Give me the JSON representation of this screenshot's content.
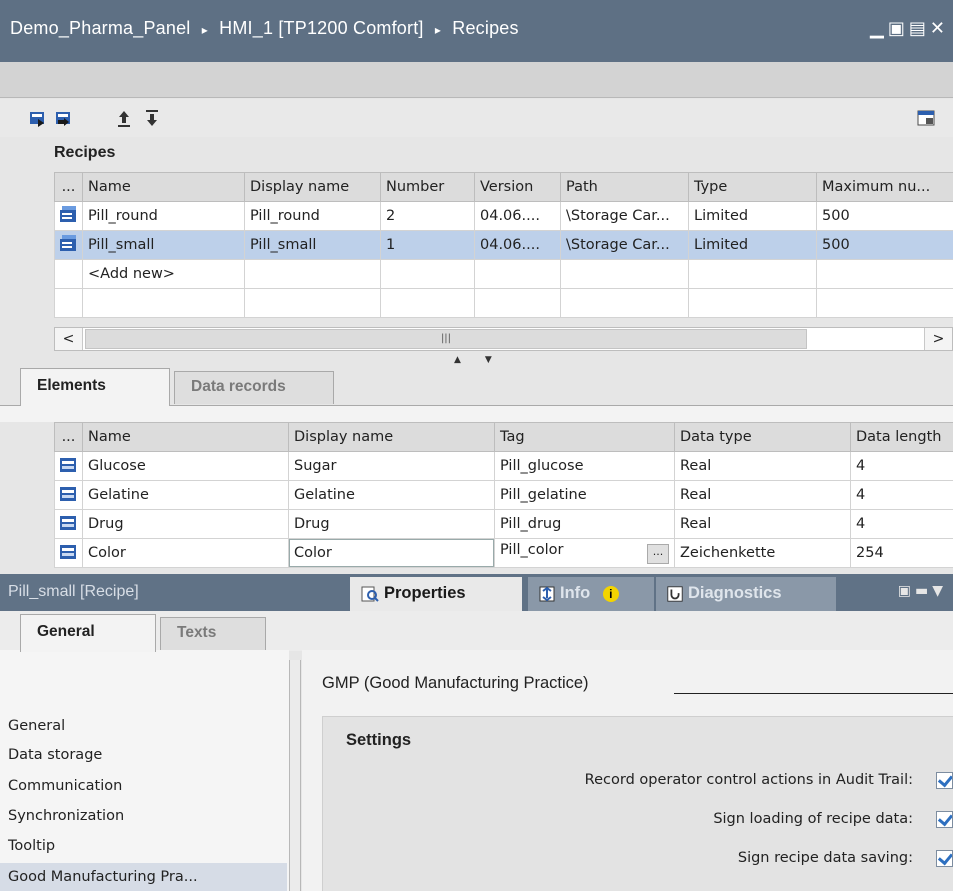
{
  "window": {
    "breadcrumb": [
      "Demo_Pharma_Panel",
      "HMI_1 [TP1200 Comfort]",
      "Recipes"
    ],
    "separator": "▸",
    "controls": "▁ ▣ ▤ ✕"
  },
  "recipes": {
    "title": "Recipes",
    "columns": [
      "...",
      "Name",
      "Display name",
      "Number",
      "Version",
      "Path",
      "Type",
      "Maximum nu..."
    ],
    "rows": [
      {
        "name": "Pill_round",
        "display_name": "Pill_round",
        "number": "2",
        "version": "04.06....",
        "path": "\\Storage Car...",
        "type": "Limited",
        "max": "500",
        "selected": false
      },
      {
        "name": "Pill_small",
        "display_name": "Pill_small",
        "number": "1",
        "version": "04.06....",
        "path": "\\Storage Car...",
        "type": "Limited",
        "max": "500",
        "selected": true
      }
    ],
    "add_new": "<Add new>",
    "scroll_grip": "|||"
  },
  "detail_tabs": [
    "Elements",
    "Data records"
  ],
  "elements": {
    "columns": [
      "...",
      "Name",
      "Display name",
      "Tag",
      "Data type",
      "Data length"
    ],
    "rows": [
      {
        "name": "Glucose",
        "display_name": "Sugar",
        "tag": "Pill_glucose",
        "data_type": "Real",
        "data_length": "4"
      },
      {
        "name": "Gelatine",
        "display_name": "Gelatine",
        "tag": "Pill_gelatine",
        "data_type": "Real",
        "data_length": "4"
      },
      {
        "name": "Drug",
        "display_name": "Drug",
        "tag": "Pill_drug",
        "data_type": "Real",
        "data_length": "4"
      },
      {
        "name": "Color",
        "display_name": "Color",
        "tag": "Pill_color",
        "data_type": "Zeichenkette",
        "data_length": "254"
      }
    ],
    "ellipsis": "..."
  },
  "inspector": {
    "object": "Pill_small [Recipe]",
    "tabs": {
      "properties": "Properties",
      "info": "Info",
      "diagnostics": "Diagnostics"
    },
    "info_badge": "i",
    "sub_tabs": [
      "General",
      "Texts"
    ],
    "nav": [
      "General",
      "Data storage",
      "Communication",
      "Synchronization",
      "Tooltip",
      "Good Manufacturing Pra..."
    ],
    "section_heading": "GMP (Good Manufacturing Practice)",
    "settings_title": "Settings",
    "settings": [
      {
        "label": "Record operator control actions in Audit Trail:",
        "checked": true
      },
      {
        "label": "Sign loading of recipe data:",
        "checked": true
      },
      {
        "label": "Sign recipe data saving:",
        "checked": true
      }
    ]
  },
  "colors": {
    "title_bar": "#5e7084",
    "selection": "#bdd0ea",
    "check": "#2d6fc0"
  }
}
